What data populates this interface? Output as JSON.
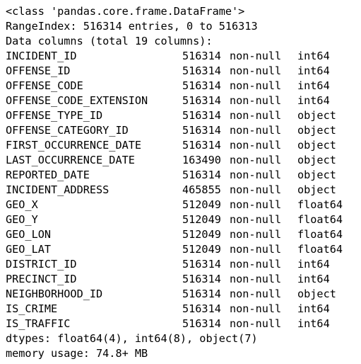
{
  "header": {
    "class_line": "<class 'pandas.core.frame.DataFrame'>",
    "range_index": "RangeIndex: 516314 entries, 0 to 516313",
    "columns_summary": "Data columns (total 19 columns):"
  },
  "columns": [
    {
      "name": "INCIDENT_ID",
      "count": "516314",
      "nullness": "non-null",
      "dtype": "int64"
    },
    {
      "name": "OFFENSE_ID",
      "count": "516314",
      "nullness": "non-null",
      "dtype": "int64"
    },
    {
      "name": "OFFENSE_CODE",
      "count": "516314",
      "nullness": "non-null",
      "dtype": "int64"
    },
    {
      "name": "OFFENSE_CODE_EXTENSION",
      "count": "516314",
      "nullness": "non-null",
      "dtype": "int64"
    },
    {
      "name": "OFFENSE_TYPE_ID",
      "count": "516314",
      "nullness": "non-null",
      "dtype": "object"
    },
    {
      "name": "OFFENSE_CATEGORY_ID",
      "count": "516314",
      "nullness": "non-null",
      "dtype": "object"
    },
    {
      "name": "FIRST_OCCURRENCE_DATE",
      "count": "516314",
      "nullness": "non-null",
      "dtype": "object"
    },
    {
      "name": "LAST_OCCURRENCE_DATE",
      "count": "163490",
      "nullness": "non-null",
      "dtype": "object"
    },
    {
      "name": "REPORTED_DATE",
      "count": "516314",
      "nullness": "non-null",
      "dtype": "object"
    },
    {
      "name": "INCIDENT_ADDRESS",
      "count": "465855",
      "nullness": "non-null",
      "dtype": "object"
    },
    {
      "name": "GEO_X",
      "count": "512049",
      "nullness": "non-null",
      "dtype": "float64"
    },
    {
      "name": "GEO_Y",
      "count": "512049",
      "nullness": "non-null",
      "dtype": "float64"
    },
    {
      "name": "GEO_LON",
      "count": "512049",
      "nullness": "non-null",
      "dtype": "float64"
    },
    {
      "name": "GEO_LAT",
      "count": "512049",
      "nullness": "non-null",
      "dtype": "float64"
    },
    {
      "name": "DISTRICT_ID",
      "count": "516314",
      "nullness": "non-null",
      "dtype": "int64"
    },
    {
      "name": "PRECINCT_ID",
      "count": "516314",
      "nullness": "non-null",
      "dtype": "int64"
    },
    {
      "name": "NEIGHBORHOOD_ID",
      "count": "516314",
      "nullness": "non-null",
      "dtype": "object"
    },
    {
      "name": "IS_CRIME",
      "count": "516314",
      "nullness": "non-null",
      "dtype": "int64"
    },
    {
      "name": "IS_TRAFFIC",
      "count": "516314",
      "nullness": "non-null",
      "dtype": "int64"
    }
  ],
  "footer": {
    "dtypes_line": "dtypes: float64(4), int64(8), object(7)",
    "memory_line": "memory usage: 74.8+ MB"
  }
}
